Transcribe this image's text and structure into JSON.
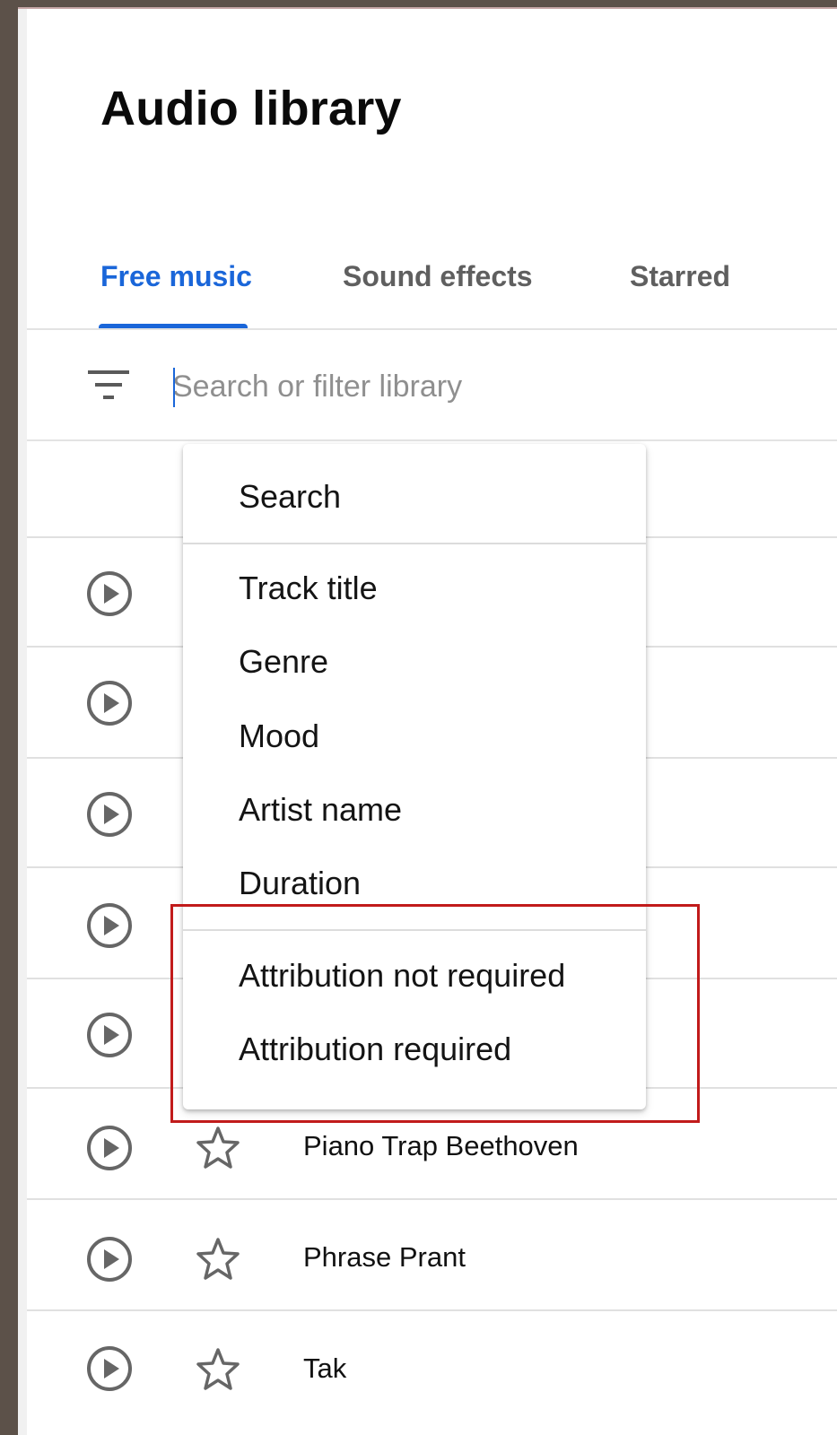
{
  "page": {
    "title": "Audio library"
  },
  "tabs": [
    {
      "label": "Free music",
      "active": true
    },
    {
      "label": "Sound effects",
      "active": false
    },
    {
      "label": "Starred",
      "active": false
    }
  ],
  "search": {
    "placeholder": "Search or filter library",
    "value": ""
  },
  "dropdown": {
    "header": "Search",
    "filters": [
      "Track title",
      "Genre",
      "Mood",
      "Artist name",
      "Duration"
    ],
    "attribution": [
      "Attribution not required",
      "Attribution required"
    ]
  },
  "tracks": [
    {
      "title": ""
    },
    {
      "title": ""
    },
    {
      "title": ""
    },
    {
      "title": ""
    },
    {
      "title": ""
    },
    {
      "title": "Piano Trap Beethoven"
    },
    {
      "title": "Phrase Prant"
    },
    {
      "title": "Tak"
    }
  ],
  "colors": {
    "accent": "#1a66d9",
    "highlight": "#c11b1b",
    "background": "#5c5149"
  },
  "icons": {
    "filter": "filter-icon",
    "play": "play-circle-icon",
    "star": "star-outline-icon"
  }
}
